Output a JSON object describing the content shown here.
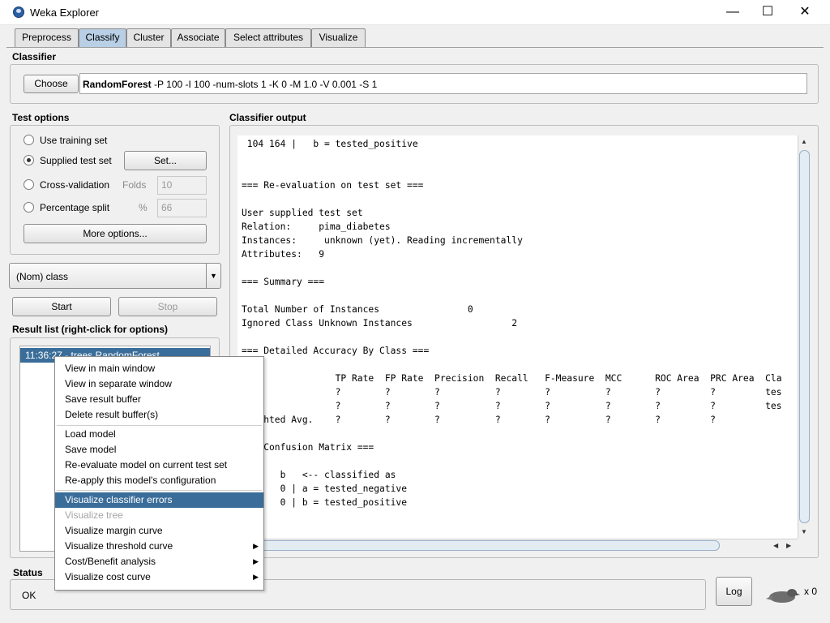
{
  "window": {
    "title": "Weka Explorer",
    "minimize": "—",
    "maximize": "☐",
    "close": "✕"
  },
  "tabs": [
    "Preprocess",
    "Classify",
    "Cluster",
    "Associate",
    "Select attributes",
    "Visualize"
  ],
  "active_tab": "Classify",
  "classifier": {
    "section": "Classifier",
    "choose_label": "Choose",
    "name": "RandomForest",
    "args": " -P 100 -I 100 -num-slots 1 -K 0 -M 1.0 -V 0.001 -S 1"
  },
  "test_options": {
    "section": "Test options",
    "use_training": "Use training set",
    "supplied_test": "Supplied test set",
    "set_button": "Set...",
    "cross_validation": "Cross-validation",
    "folds_label": "Folds",
    "folds_value": "10",
    "percentage_split": "Percentage split",
    "percent_label": "%",
    "percent_value": "66",
    "more_options": "More options...",
    "selected": "supplied_test"
  },
  "class_select": "(Nom) class",
  "start_label": "Start",
  "stop_label": "Stop",
  "result_list": {
    "section": "Result list (right-click for options)",
    "item": "11:36:27 - trees.RandomForest"
  },
  "output": {
    "section": "Classifier output",
    "lines": [
      " 104 164 |   b = tested_positive",
      "",
      "",
      "=== Re-evaluation on test set ===",
      "",
      "User supplied test set",
      "Relation:     pima_diabetes",
      "Instances:     unknown (yet). Reading incrementally",
      "Attributes:   9",
      "",
      "=== Summary ===",
      "",
      "Total Number of Instances                0",
      "Ignored Class Unknown Instances                  2",
      "",
      "=== Detailed Accuracy By Class ===",
      "",
      "                 TP Rate  FP Rate  Precision  Recall   F-Measure  MCC      ROC Area  PRC Area  Cla",
      "                 ?        ?        ?          ?        ?          ?        ?         ?         tes",
      "                 ?        ?        ?          ?        ?          ?        ?         ?         tes",
      "Weighted Avg.    ?        ?        ?          ?        ?          ?        ?         ?",
      "",
      "=== Confusion Matrix ===",
      "",
      "   a   b   <-- classified as",
      "   0   0 | a = tested_negative",
      "   0   0 | b = tested_positive"
    ]
  },
  "context_menu": {
    "items": [
      "View in main window",
      "View in separate window",
      "Save result buffer",
      "Delete result buffer(s)",
      "Load model",
      "Save model",
      "Re-evaluate model on current test set",
      "Re-apply this model's configuration",
      "Visualize classifier errors",
      "Visualize tree",
      "Visualize margin curve",
      "Visualize threshold curve",
      "Cost/Benefit analysis",
      "Visualize cost curve"
    ],
    "selected": "Visualize classifier errors",
    "disabled": [
      "Visualize tree"
    ]
  },
  "status": {
    "section": "Status",
    "text": "OK",
    "log_label": "Log",
    "x_count": "x 0"
  }
}
